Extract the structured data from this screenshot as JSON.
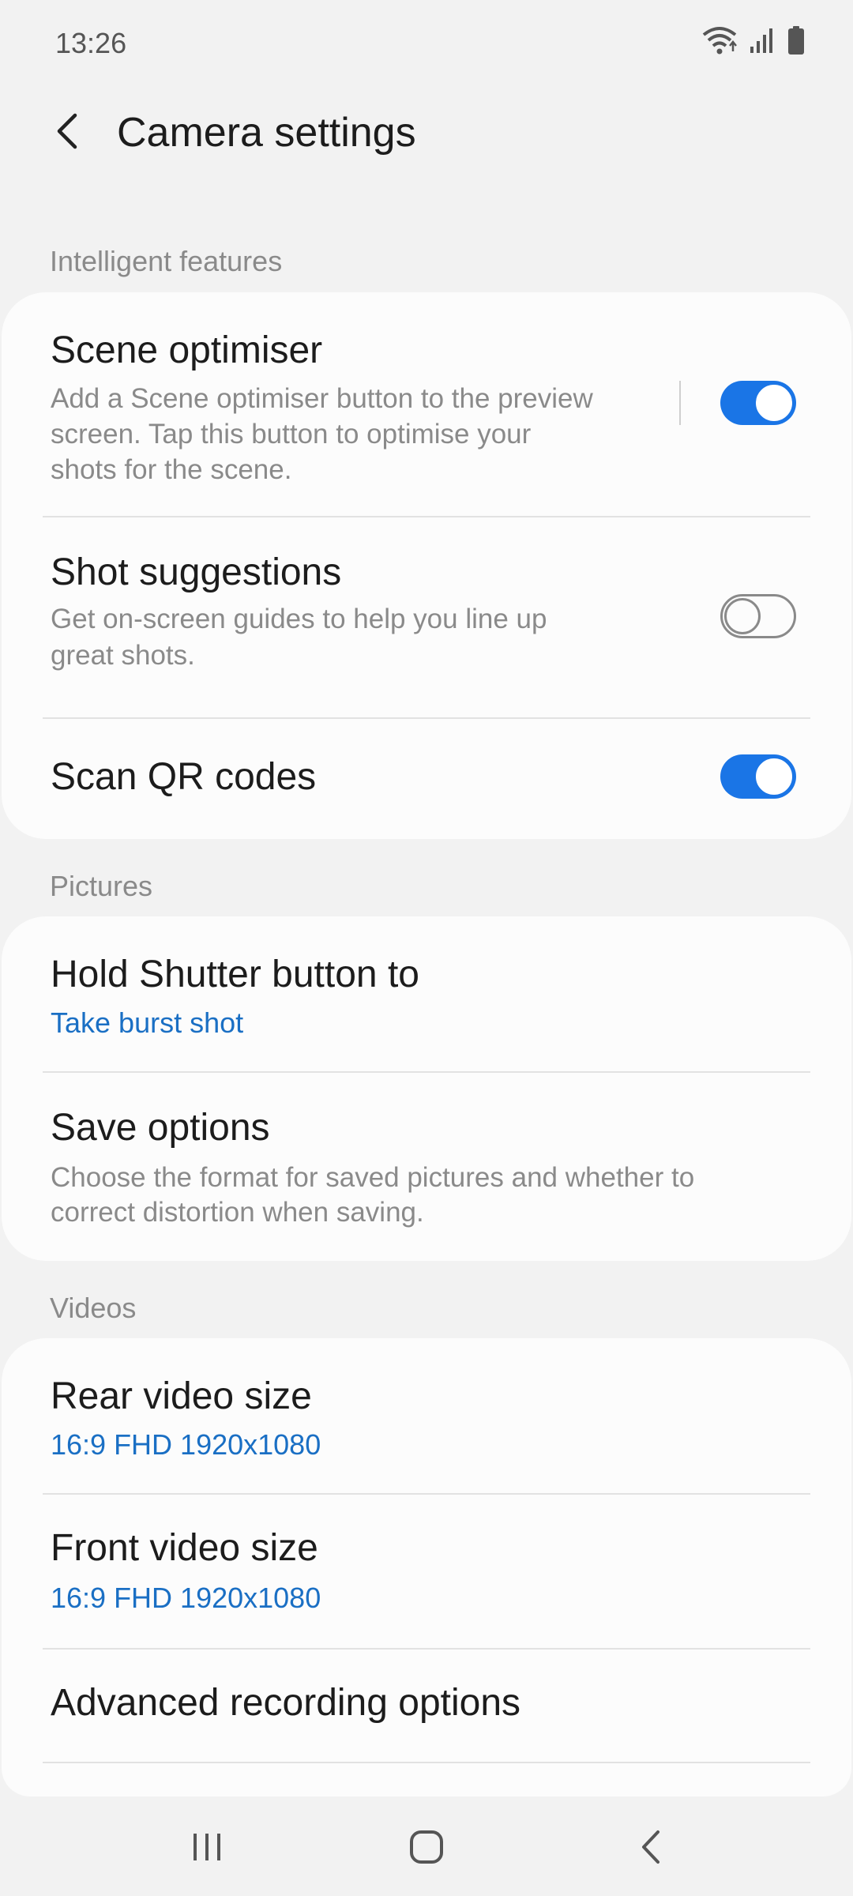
{
  "status_bar": {
    "time": "13:26"
  },
  "app_bar": {
    "title": "Camera settings"
  },
  "sections": {
    "intelligent": {
      "label": "Intelligent features",
      "scene_optimiser": {
        "title": "Scene optimiser",
        "desc_line1": "Add a Scene optimiser button to the preview",
        "desc_line2": "screen. Tap this button to optimise your",
        "desc_line3": "shots for the scene.",
        "enabled": true
      },
      "shot_suggestions": {
        "title": "Shot suggestions",
        "desc_line1": "Get on-screen guides to help you line up",
        "desc_line2": "great shots.",
        "enabled": false
      },
      "scan_qr": {
        "title": "Scan QR codes",
        "enabled": true
      }
    },
    "pictures": {
      "label": "Pictures",
      "hold_shutter": {
        "title": "Hold Shutter button to",
        "value": "Take burst shot"
      },
      "save_options": {
        "title": "Save options",
        "desc_line1": "Choose the format for saved pictures and whether to",
        "desc_line2": "correct distortion when saving."
      }
    },
    "videos": {
      "label": "Videos",
      "rear_video": {
        "title": "Rear video size",
        "value": "16:9 FHD 1920x1080"
      },
      "front_video": {
        "title": "Front video size",
        "value": "16:9 FHD 1920x1080"
      },
      "advanced": {
        "title": "Advanced recording options"
      }
    }
  },
  "colors": {
    "accent": "#1a75e6",
    "value_text": "#1a6fc4",
    "background": "#f2f2f2",
    "card": "#fcfcfc"
  },
  "icons": {
    "back": "chevron-left-icon",
    "wifi": "wifi-icon",
    "signal": "signal-icon",
    "battery": "battery-icon",
    "recents": "recents-icon",
    "home": "home-icon",
    "nav_back": "nav-back-icon"
  }
}
